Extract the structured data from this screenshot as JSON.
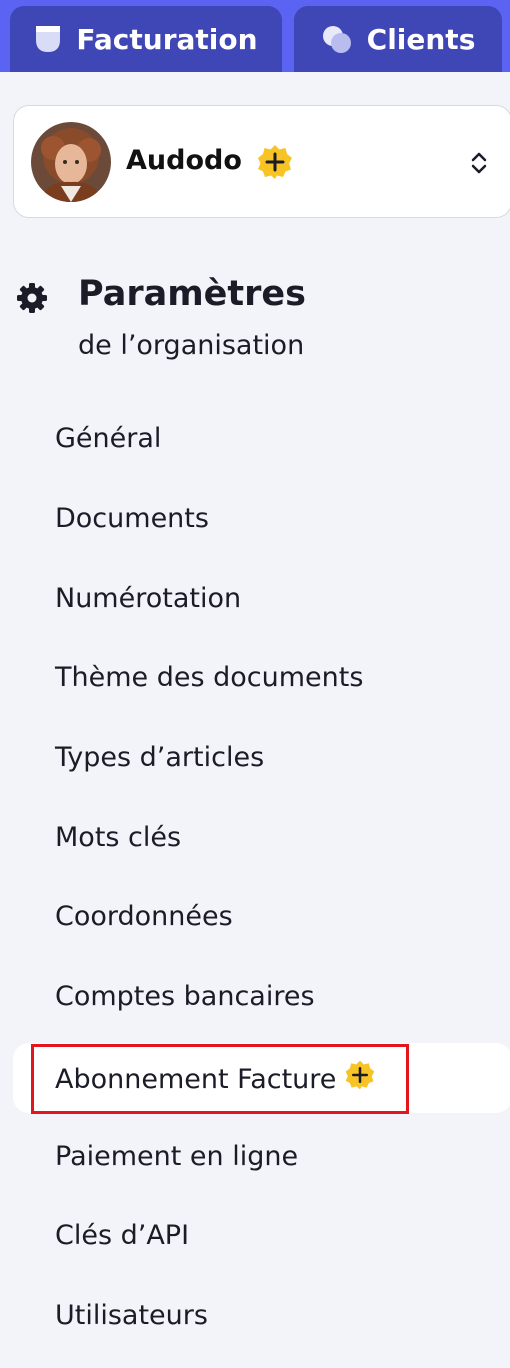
{
  "tabs": [
    {
      "label": "Facturation",
      "icon": "invoice-icon"
    },
    {
      "label": "Clients",
      "icon": "clients-icon"
    }
  ],
  "organization": {
    "name": "Audodo",
    "badge_icon": "plus-badge-icon",
    "selector_icon": "chevron-up-down-icon"
  },
  "settings": {
    "title": "Paramètres",
    "subtitle": "de l’organisation",
    "icon": "gear-icon"
  },
  "menu": [
    {
      "label": "Général"
    },
    {
      "label": "Documents"
    },
    {
      "label": "Numérotation"
    },
    {
      "label": "Thème des documents"
    },
    {
      "label": "Types d’articles"
    },
    {
      "label": "Mots clés"
    },
    {
      "label": "Coordonnées"
    },
    {
      "label": "Comptes bancaires"
    },
    {
      "label": "Abonnement Facture",
      "active": true,
      "badge_icon": "plus-badge-icon"
    },
    {
      "label": "Paiement en ligne"
    },
    {
      "label": "Clés d’API"
    },
    {
      "label": "Utilisateurs"
    }
  ],
  "colors": {
    "topbar": "#5b63f3",
    "tab": "#3f46b6",
    "badge": "#f7c325",
    "highlight": "#e4151c",
    "background": "#f3f4f9"
  }
}
